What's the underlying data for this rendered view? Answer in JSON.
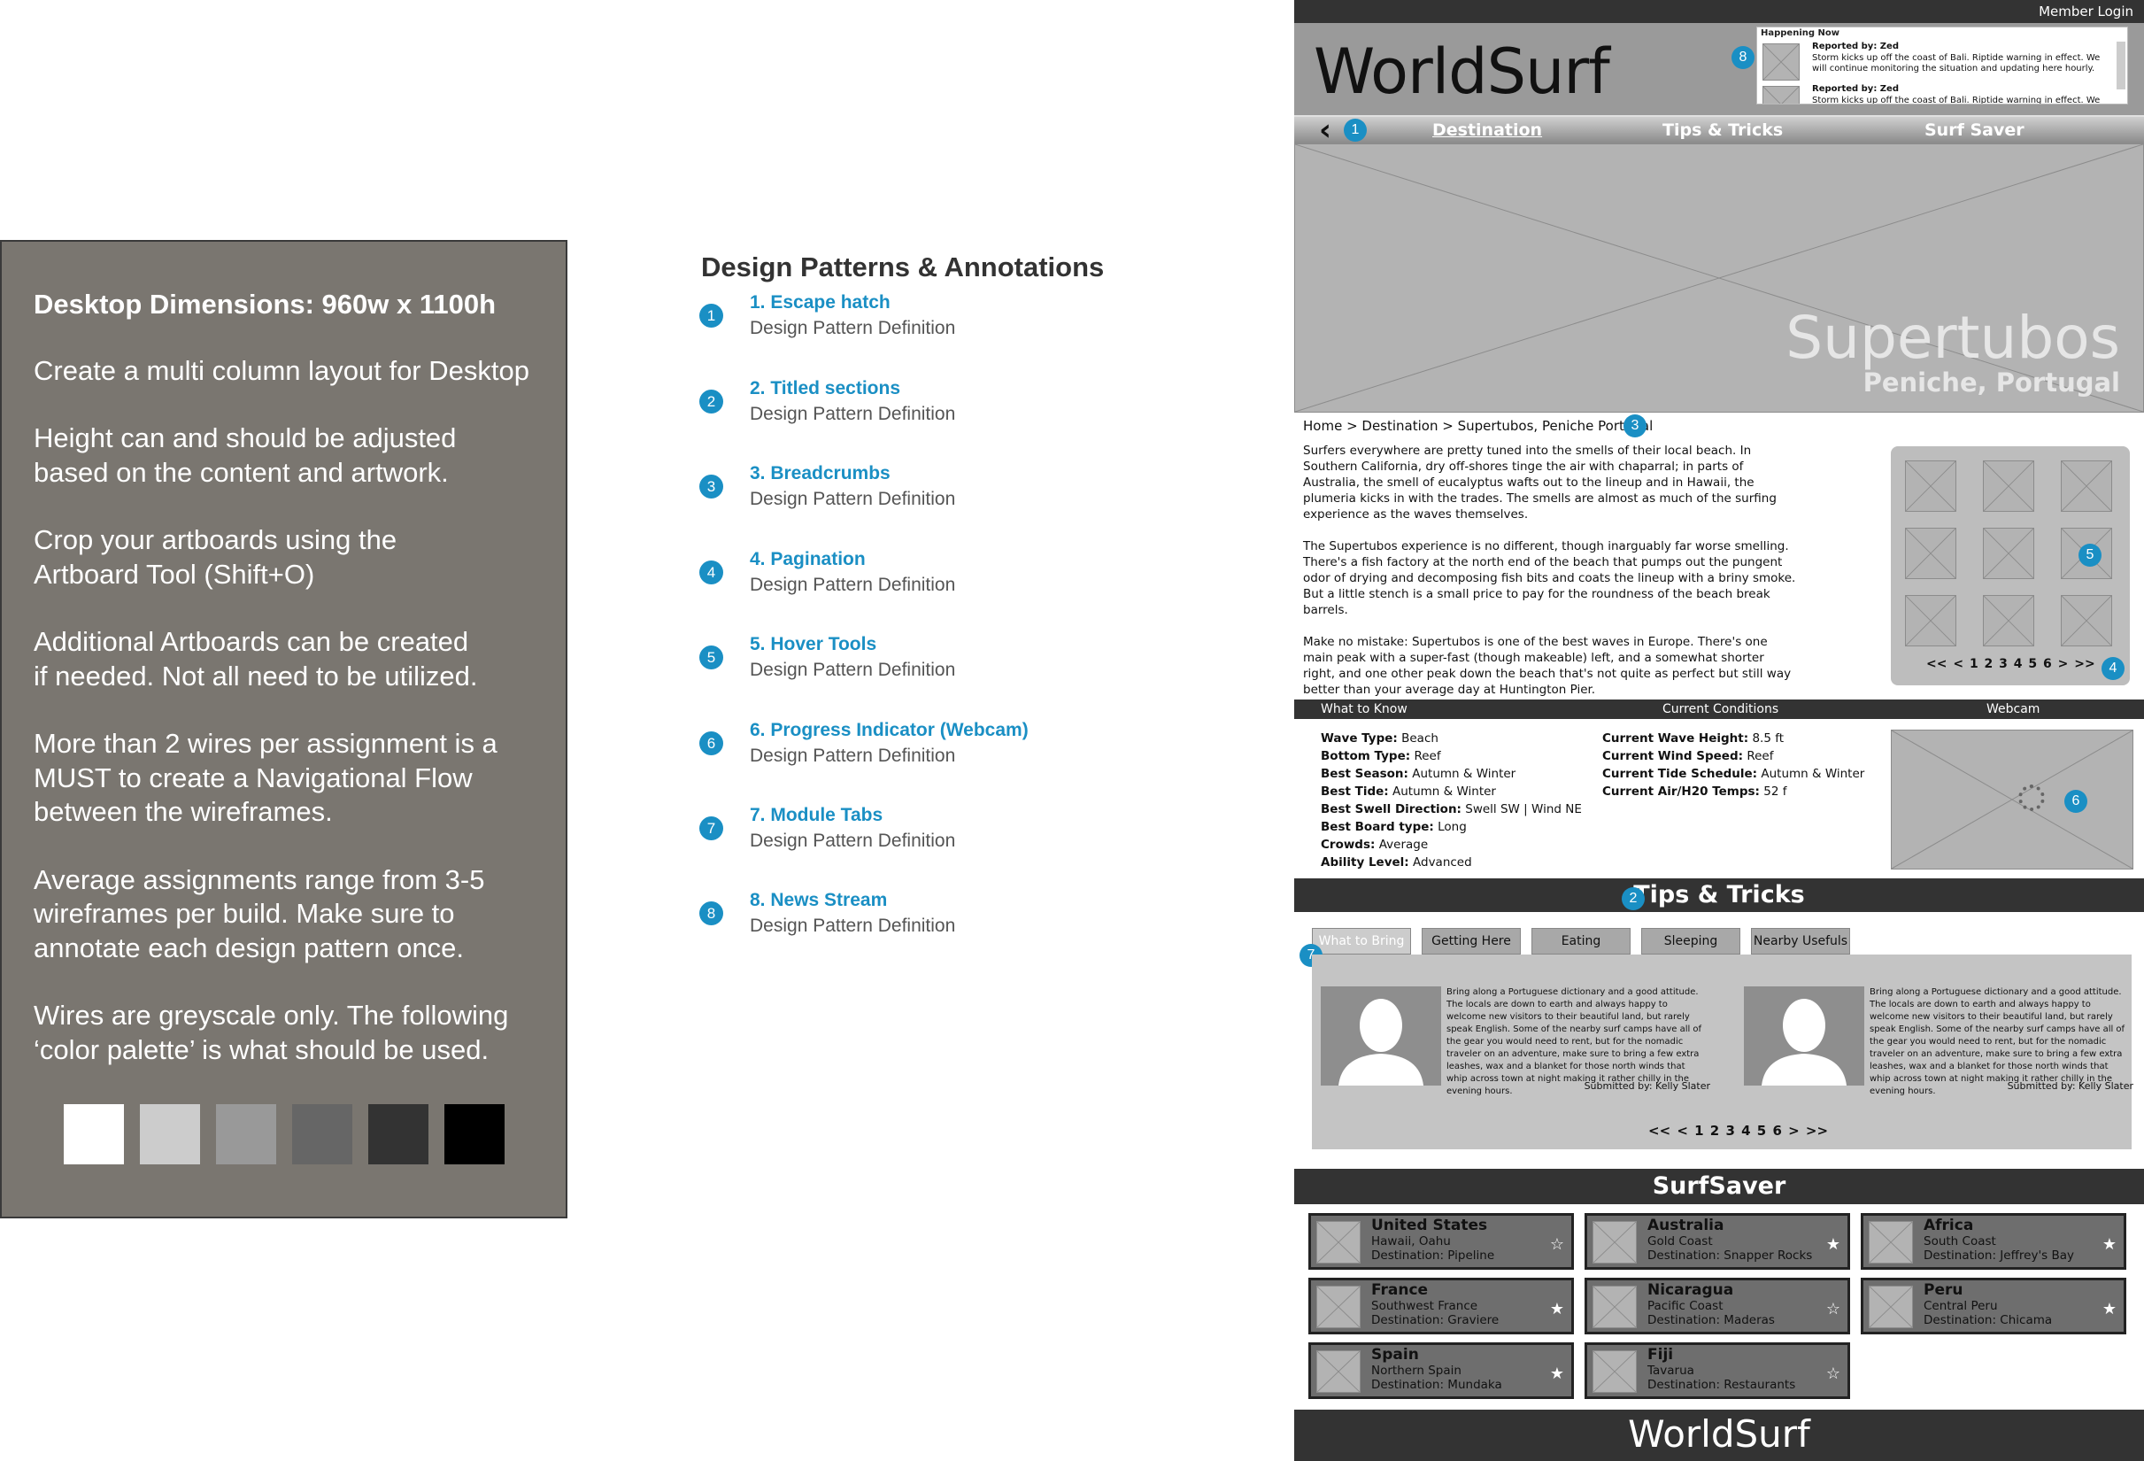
{
  "instructions": {
    "lines": [
      "Desktop Dimensions: 960w x 1100h",
      "Create a multi column layout for Desktop",
      "Height can and should be adjusted\nbased on the content and artwork.",
      "Crop your artboards using the\nArtboard Tool  (Shift+O)",
      "Additional Artboards can be created\nif needed. Not all need to be utilized.",
      "More than 2 wires per assignment is a\nMUST to create a Navigational Flow\nbetween the wireframes.",
      "Average assignments range from 3-5\nwireframes per build. Make sure to\nannotate each design pattern once.",
      "Wires are greyscale only. The following\n‘color palette’ is what should be used."
    ],
    "palette": [
      "#ffffff",
      "#cccccc",
      "#999999",
      "#666666",
      "#333333",
      "#000000"
    ]
  },
  "annotations": {
    "title": "Design Patterns & Annotations",
    "items": [
      {
        "num": "1",
        "title": "1. Escape hatch",
        "def": "Design Pattern Definition"
      },
      {
        "num": "2",
        "title": "2. Titled sections",
        "def": "Design Pattern Definition"
      },
      {
        "num": "3",
        "title": "3. Breadcrumbs",
        "def": "Design Pattern Definition"
      },
      {
        "num": "4",
        "title": "4. Pagination",
        "def": "Design Pattern Definition"
      },
      {
        "num": "5",
        "title": "5. Hover Tools",
        "def": "Design Pattern Definition"
      },
      {
        "num": "6",
        "title": "6. Progress Indicator (Webcam)",
        "def": "Design Pattern Definition"
      },
      {
        "num": "7",
        "title": "7. Module Tabs",
        "def": "Design Pattern Definition"
      },
      {
        "num": "8",
        "title": "8. News Stream",
        "def": "Design Pattern Definition"
      }
    ]
  },
  "wire": {
    "member_login": "Member Login",
    "logo": "WorldSurf",
    "news": {
      "heading": "Happening Now",
      "items": [
        {
          "by": "Reported by: Zed",
          "text": "Storm kicks up off the coast of Bali.  Riptide warning in effect. We will continue monitoring the situation and updating here hourly."
        },
        {
          "by": "Reported by: Zed",
          "text": "Storm kicks up off the coast of Bali.  Riptide warning in effect. We will"
        }
      ]
    },
    "nav": {
      "back": "‹",
      "tabs": [
        "Destination",
        "Tips & Tricks",
        "Surf Saver"
      ]
    },
    "hero": {
      "title": "Supertubos",
      "subtitle": "Peniche, Portugal"
    },
    "breadcrumb": "Home > Destination > Supertubos, Peniche Portugal",
    "intro": [
      "Surfers everywhere are pretty tuned into the smells of their local beach.  In Southern California, dry off-shores tinge the air with chaparral; in parts of Australia, the smell of eucalyptus wafts out to the lineup and in Hawaii, the plumeria kicks in with the trades. The smells are almost as much of the surfing experience as the waves themselves.",
      "The Supertubos experience is no different, though inarguably far worse smelling. There's a fish factory at the north end of the beach that pumps out the pungent odor of drying and decomposing fish bits and coats the lineup with a briny smoke. But a little stench is a small price to pay for the roundness of the beach break barrels.",
      "Make no mistake: Supertubos is one of the best waves in Europe. There's one main peak with a super-fast (though makeable) left, and a somewhat shorter right, and one other peak down the beach that's not quite as perfect but still way better than your average day at Huntington Pier."
    ],
    "gallery_pager": "<<  <  1 2 3 4 5 6  >  >>",
    "info_head": [
      "What to Know",
      "Current Conditions",
      "Webcam"
    ],
    "know": [
      {
        "k": "Wave Type:",
        "v": "Beach"
      },
      {
        "k": "Bottom Type:",
        "v": "Reef"
      },
      {
        "k": "Best Season:",
        "v": "Autumn & Winter"
      },
      {
        "k": "Best Tide:",
        "v": "Autumn & Winter"
      },
      {
        "k": "Best Swell Direction:",
        "v": "Swell SW | Wind NE"
      },
      {
        "k": "Best Board type:",
        "v": "Long"
      },
      {
        "k": "Crowds:",
        "v": "Average"
      },
      {
        "k": "Ability Level:",
        "v": "Advanced"
      }
    ],
    "conditions": [
      {
        "k": "Current Wave Height:",
        "v": "8.5 ft"
      },
      {
        "k": "Current Wind Speed:",
        "v": "Reef"
      },
      {
        "k": "Current Tide Schedule:",
        "v": "Autumn & Winter"
      },
      {
        "k": "Current Air/H20 Temps:",
        "v": "52 f"
      }
    ],
    "tips_title": "Tips & Tricks",
    "module_tabs": [
      "What to Bring",
      "Getting Here",
      "Eating",
      "Sleeping",
      "Nearby Usefuls"
    ],
    "tips": [
      {
        "text": "Bring along a Portuguese dictionary and a good attitude. The locals are down to earth and always happy to welcome new visitors to their beautiful land, but rarely speak English. Some of the nearby surf camps have all of the gear you would need to rent, but for the nomadic traveler on an adventure, make sure to bring a few extra leashes, wax and a blanket for those north winds that whip across town at night making it rather chilly in the evening hours.",
        "by": "Submitted by: Kelly Slater"
      },
      {
        "text": "Bring along a Portuguese dictionary and a good attitude. The locals are down to earth and always happy to welcome new visitors to their beautiful land, but rarely speak English. Some of the nearby surf camps have all of the gear you would need to rent, but for the nomadic traveler on an adventure, make sure to bring a few extra leashes, wax and a blanket for those north winds that whip across town at night making it rather chilly in the evening hours.",
        "by": "Submitted by: Kelly Slater"
      }
    ],
    "tips_pager": "<<  <  1 2 3 4 5 6  >  >>",
    "saver_title": "SurfSaver",
    "destinations": [
      {
        "country": "United States",
        "region": "Hawaii, Oahu",
        "dest": "Destination: Pipeline",
        "star": "☆"
      },
      {
        "country": "Australia",
        "region": "Gold Coast",
        "dest": "Destination: Snapper Rocks",
        "star": "★"
      },
      {
        "country": "Africa",
        "region": "South Coast",
        "dest": "Destination: Jeffrey's Bay",
        "star": "★"
      },
      {
        "country": "France",
        "region": "Southwest France",
        "dest": "Destination: Graviere",
        "star": "★"
      },
      {
        "country": "Nicaragua",
        "region": "Pacific Coast",
        "dest": "Destination: Maderas",
        "star": "☆"
      },
      {
        "country": "Peru",
        "region": "Central Peru",
        "dest": "Destination: Chicama",
        "star": "★"
      },
      {
        "country": "Spain",
        "region": "Northern Spain",
        "dest": "Destination: Mundaka",
        "star": "★"
      },
      {
        "country": "Fiji",
        "region": "Tavarua",
        "dest": "Destination: Restaurants",
        "star": "☆"
      }
    ],
    "footer": "WorldSurf"
  }
}
